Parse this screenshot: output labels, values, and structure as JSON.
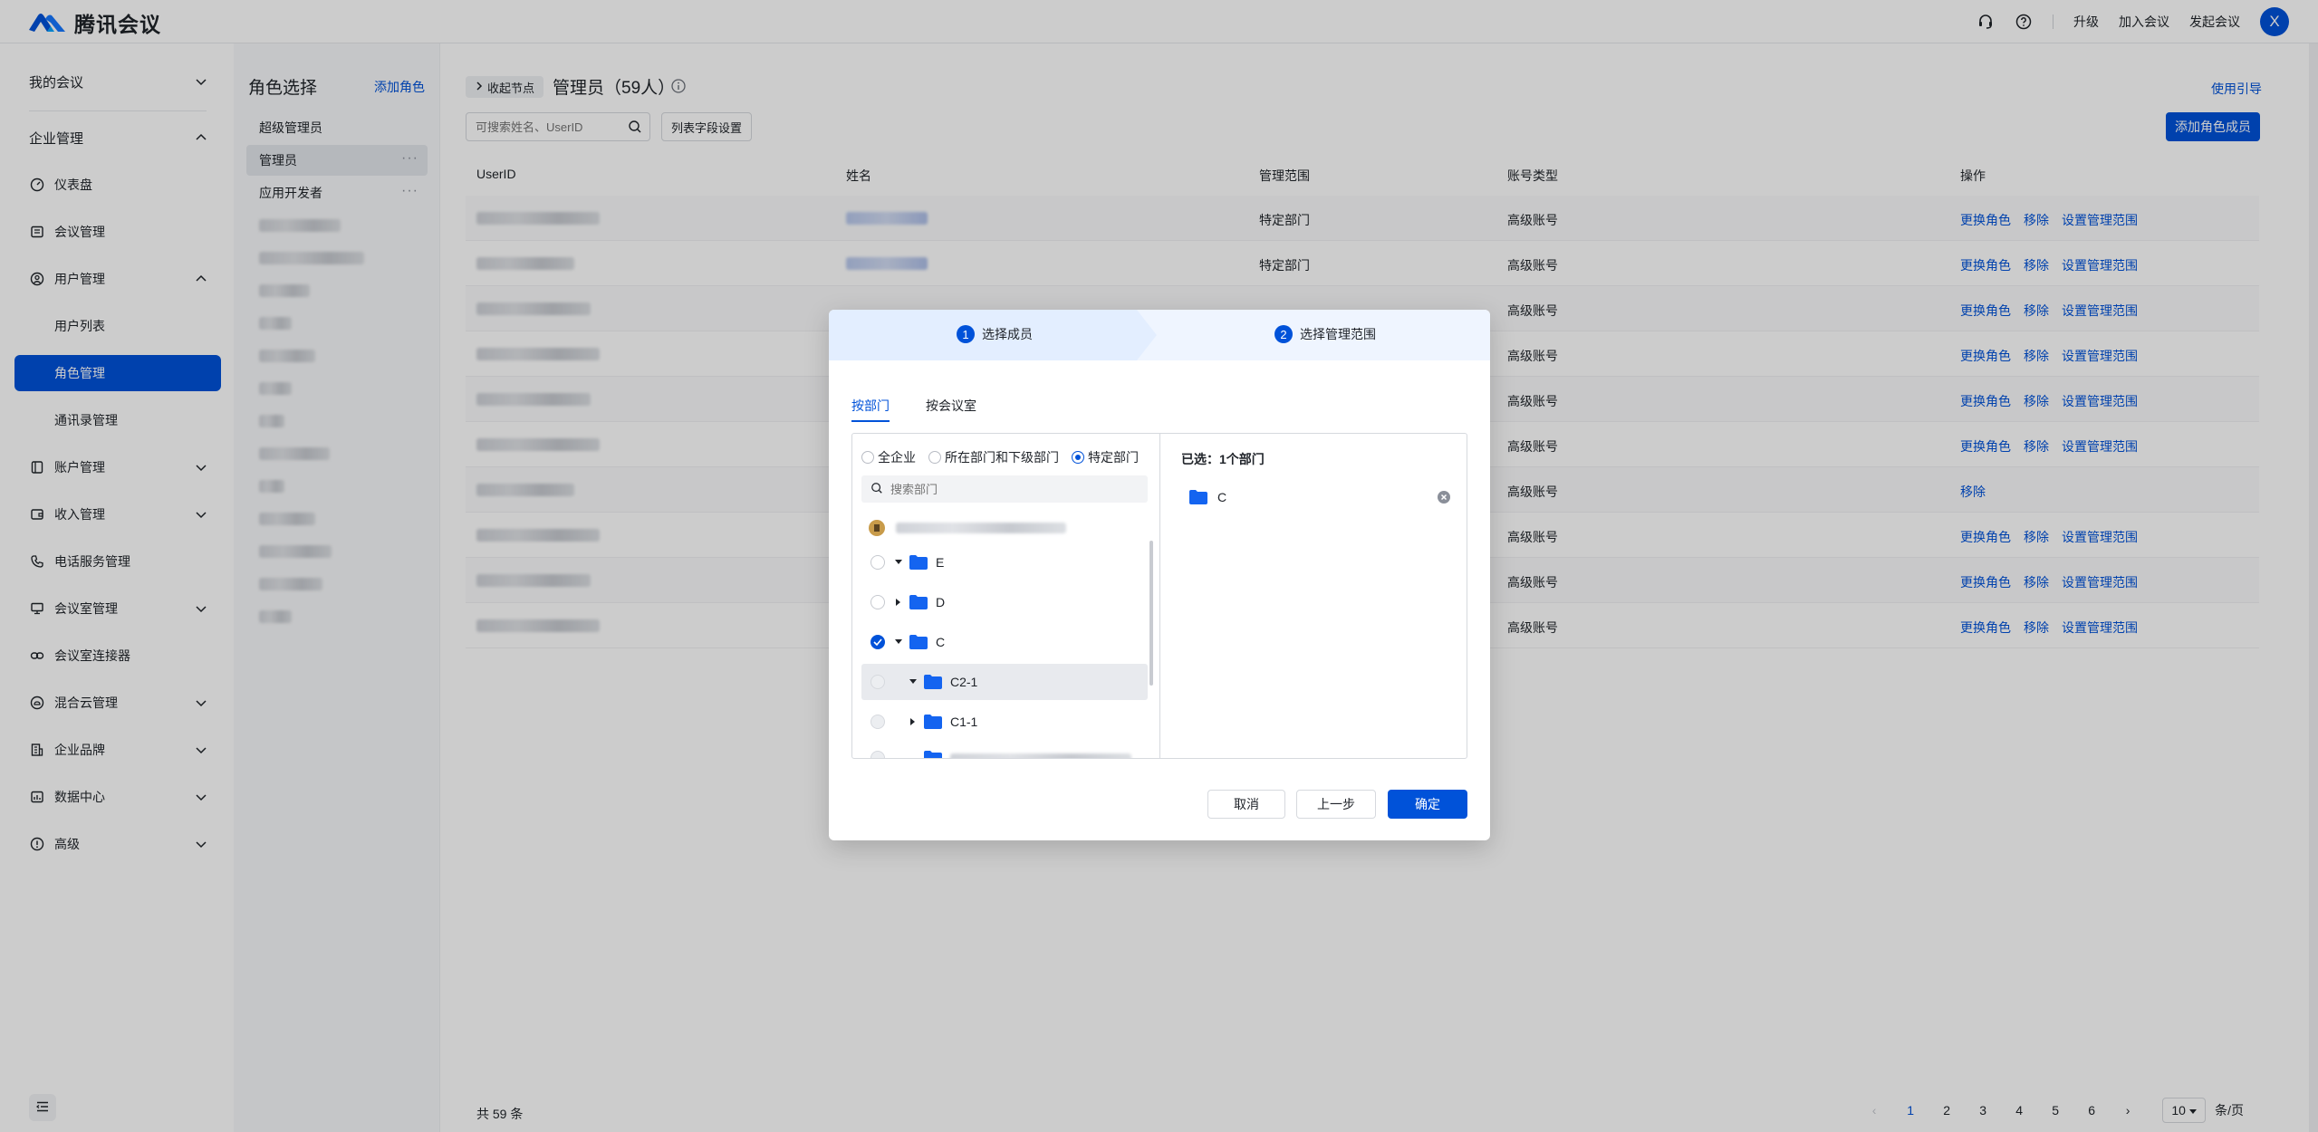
{
  "brand": {
    "name": "腾讯会议"
  },
  "topbar": {
    "upgrade": "升级",
    "join": "加入会议",
    "start": "发起会议",
    "avatar": "X"
  },
  "sidenav": {
    "my_meetings": "我的会议",
    "enterprise": "企业管理",
    "items": {
      "dashboard": "仪表盘",
      "meeting_mgmt": "会议管理",
      "user_mgmt": "用户管理",
      "user_list": "用户列表",
      "role_mgmt": "角色管理",
      "contacts_mgmt": "通讯录管理",
      "account_mgmt": "账户管理",
      "income_mgmt": "收入管理",
      "phone_mgmt": "电话服务管理",
      "room_mgmt": "会议室管理",
      "room_connector": "会议室连接器",
      "hybrid_cloud": "混合云管理",
      "brand": "企业品牌",
      "data_center": "数据中心",
      "advanced": "高级"
    }
  },
  "roles": {
    "title": "角色选择",
    "add": "添加角色",
    "items": [
      "超级管理员",
      "管理员",
      "应用开发者"
    ],
    "more": "···"
  },
  "main": {
    "collapse_nodes": "收起节点",
    "title": "管理员（59人）",
    "guide": "使用引导",
    "search_placeholder": "可搜索姓名、UserID",
    "field_settings": "列表字段设置",
    "add_member": "添加角色成员",
    "columns": {
      "userid": "UserID",
      "name": "姓名",
      "scope": "管理范围",
      "type": "账号类型",
      "ops": "操作"
    },
    "rows": [
      {
        "scope": "特定部门",
        "type": "高级账号",
        "ops": [
          "更换角色",
          "移除",
          "设置管理范围"
        ]
      },
      {
        "scope": "特定部门",
        "type": "高级账号",
        "ops": [
          "更换角色",
          "移除",
          "设置管理范围"
        ]
      },
      {
        "scope": "",
        "type": "高级账号",
        "ops": [
          "更换角色",
          "移除",
          "设置管理范围"
        ]
      },
      {
        "scope": "",
        "type": "高级账号",
        "ops": [
          "更换角色",
          "移除",
          "设置管理范围"
        ]
      },
      {
        "scope": "",
        "type": "高级账号",
        "ops": [
          "更换角色",
          "移除",
          "设置管理范围"
        ]
      },
      {
        "scope": "",
        "type": "高级账号",
        "ops": [
          "更换角色",
          "移除",
          "设置管理范围"
        ]
      },
      {
        "scope": "",
        "type": "高级账号",
        "ops": [
          "移除"
        ]
      },
      {
        "scope": "",
        "type": "高级账号",
        "ops": [
          "更换角色",
          "移除",
          "设置管理范围"
        ]
      },
      {
        "scope": "",
        "type": "高级账号",
        "ops": [
          "更换角色",
          "移除",
          "设置管理范围"
        ]
      },
      {
        "scope": "",
        "type": "高级账号",
        "ops": [
          "更换角色",
          "移除",
          "设置管理范围"
        ]
      }
    ],
    "total": "共 59 条",
    "pages": [
      "1",
      "2",
      "3",
      "4",
      "5",
      "6"
    ],
    "page_size": "10",
    "per_page": "条/页"
  },
  "modal": {
    "step1": {
      "num": "1",
      "label": "选择成员"
    },
    "step2": {
      "num": "2",
      "label": "选择管理范围"
    },
    "tabs": [
      "按部门",
      "按会议室"
    ],
    "scope_options": [
      "全企业",
      "所在部门和下级部门",
      "特定部门"
    ],
    "search_placeholder": "搜索部门",
    "tree": [
      {
        "label": "E",
        "expanded": true
      },
      {
        "label": "D",
        "expanded": false
      },
      {
        "label": "C",
        "expanded": true,
        "checked": true
      },
      {
        "label": "C2-1",
        "expanded": true
      },
      {
        "label": "C1-1",
        "expanded": false
      }
    ],
    "selected_title": "已选：1个部门",
    "selected_items": [
      "C"
    ],
    "cancel": "取消",
    "prev": "上一步",
    "confirm": "确定"
  },
  "colors": {
    "primary": "#0052d9"
  }
}
